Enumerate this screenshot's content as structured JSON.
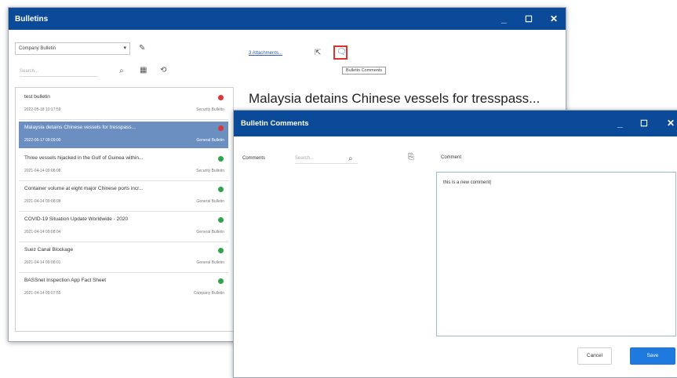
{
  "main": {
    "title": "Bulletins",
    "filter_select": "Company Bulletin",
    "search_placeholder": "Search...",
    "attachments_link": "3 Attachments...",
    "tooltip": "Bulletin Comments",
    "headline": "Malaysia detains Chinese vessels for tresspass...",
    "bulletins": [
      {
        "title": "test bulletin",
        "date": "2022-05-18 10:17:59",
        "type": "Security Bulletin",
        "status_color": "#d9373b"
      },
      {
        "title": "Malaysia detains Chinese vessels for tresspass...",
        "date": "2022-05-17 09:09:00",
        "type": "General Bulletin",
        "status_color": "#d9373b"
      },
      {
        "title": "Three vessels hijacked in the Gulf of Guinea within...",
        "date": "2021-04-14 09:08:08",
        "type": "Security Bulletin",
        "status_color": "#2ea44f"
      },
      {
        "title": "Container volume at eight major Chinese ports incr...",
        "date": "2021-04-14 09:08:08",
        "type": "General Bulletin",
        "status_color": "#2ea44f"
      },
      {
        "title": "COVID-19 Situation Update Worldwide - 2020",
        "date": "2021-04-14 09:08:04",
        "type": "General Bulletin",
        "status_color": "#2ea44f"
      },
      {
        "title": "Suez Canal Blockage",
        "date": "2021-04-14 09:08:01",
        "type": "General Bulletin",
        "status_color": "#2ea44f"
      },
      {
        "title": "BASSnet Inspection App Fact Sheet",
        "date": "2021-04-14 09:07:55",
        "type": "Company Bulletin",
        "status_color": "#2ea44f"
      }
    ]
  },
  "dialog": {
    "title": "Bulletin Comments",
    "comments_label": "Comments",
    "search_placeholder": "Search...",
    "comment_label": "Comment",
    "comment_text": "this is a new comment|",
    "cancel": "Cancel",
    "save": "Save"
  }
}
